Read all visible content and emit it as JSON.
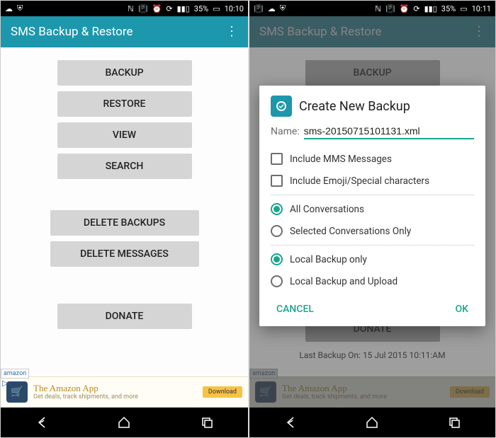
{
  "left": {
    "status": {
      "battery": "35%",
      "time": "10:10"
    },
    "app_title": "SMS Backup & Restore",
    "buttons": {
      "backup": "BACKUP",
      "restore": "RESTORE",
      "view": "VIEW",
      "search": "SEARCH",
      "delete_backups": "DELETE BACKUPS",
      "delete_messages": "DELETE MESSAGES",
      "donate": "DONATE"
    },
    "ad": {
      "badge": "amazon",
      "title": "The Amazon App",
      "subtitle": "Get deals, track shipments, and more",
      "download": "Download"
    }
  },
  "right": {
    "status": {
      "battery": "35%",
      "time": "10:11"
    },
    "app_title": "SMS Backup & Restore",
    "buttons": {
      "backup": "BACKUP",
      "donate": "DONATE"
    },
    "last_backup": "Last Backup On: 15 Jul 2015 10:11:AM",
    "ad": {
      "badge": "amazon",
      "title": "The Amazon App",
      "subtitle": "Get deals, track shipments, and more",
      "download": "Download"
    },
    "dialog": {
      "title": "Create New Backup",
      "name_label": "Name:",
      "name_value": "sms-20150715101131.xml",
      "include_mms": "Include MMS Messages",
      "include_emoji": "Include Emoji/Special characters",
      "all_conv": "All Conversations",
      "sel_conv": "Selected Conversations Only",
      "local_only": "Local Backup only",
      "local_upload": "Local Backup and Upload",
      "cancel": "CANCEL",
      "ok": "OK"
    }
  }
}
